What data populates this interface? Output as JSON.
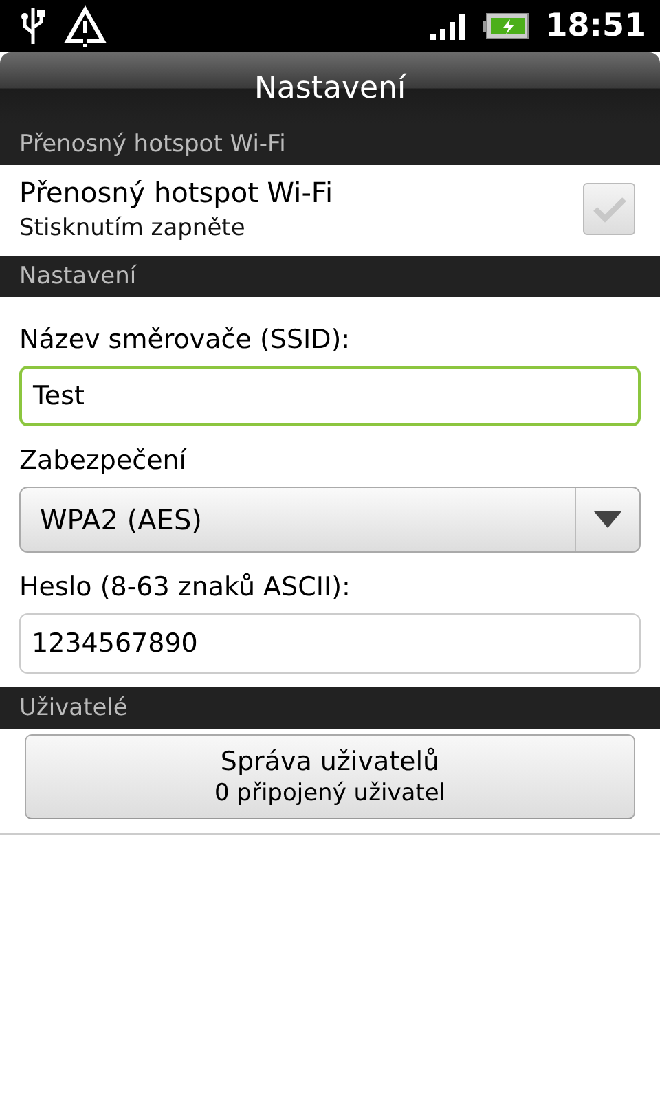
{
  "status_bar": {
    "time": "18:51"
  },
  "title": "Nastavení",
  "sections": [
    {
      "header": "Přenosný hotspot Wi-Fi",
      "items": [
        {
          "kind": "check",
          "title": "Přenosný hotspot Wi-Fi",
          "summary": "Stisknutím zapněte",
          "checked": false
        }
      ]
    },
    {
      "header": "Nastavení",
      "items": [
        {
          "kind": "text",
          "label": "Název směrovače (SSID):",
          "value": "Test",
          "focused": true
        },
        {
          "kind": "select",
          "label": "Zabezpečení",
          "value": "WPA2 (AES)"
        },
        {
          "kind": "text",
          "label": "Heslo (8-63 znaků ASCII):",
          "value": "1234567890",
          "focused": false
        }
      ]
    },
    {
      "header": "Uživatelé",
      "items": [
        {
          "kind": "button",
          "title": "Správa uživatelů",
          "summary": "0 připojený uživatel"
        }
      ]
    }
  ]
}
